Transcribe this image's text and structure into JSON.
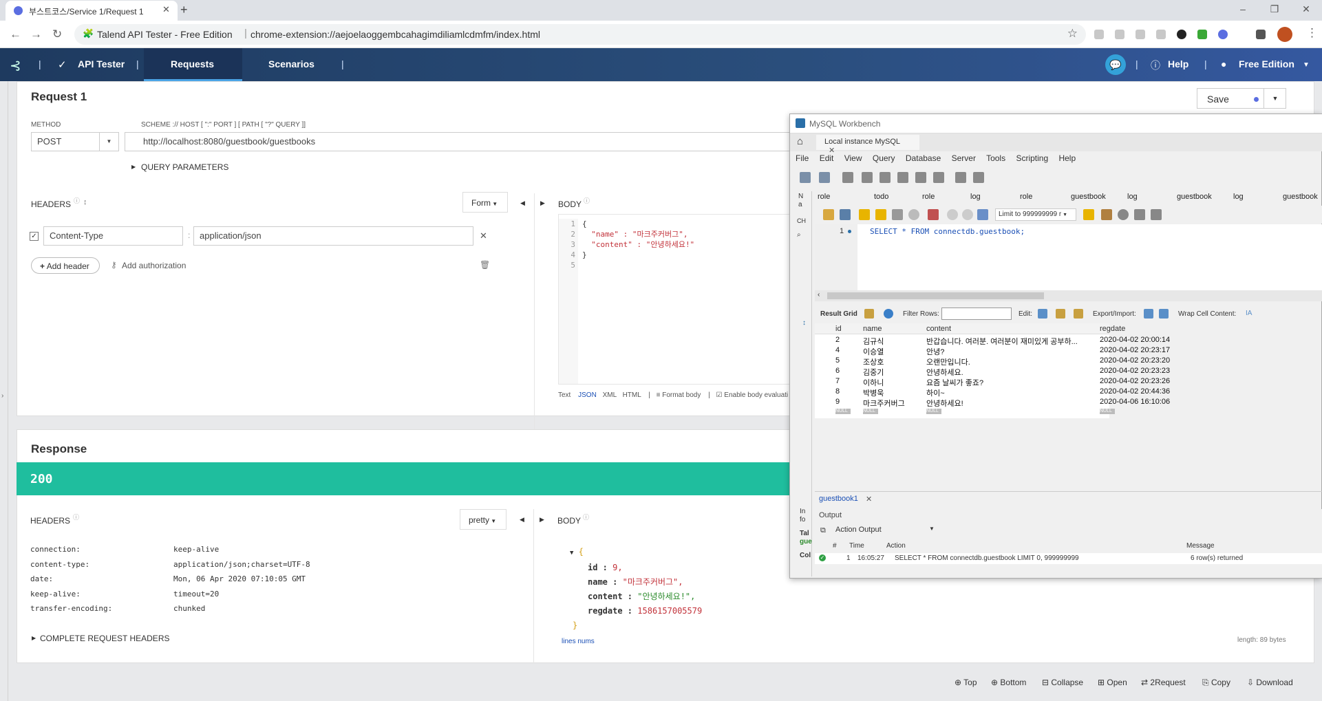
{
  "browser": {
    "tab_title": "부스트코스/Service 1/Request 1",
    "address_site": "Talend API Tester - Free Edition",
    "address_url": "chrome-extension://aejoelaoggembcahagimdiliamlcdmfm/index.html"
  },
  "app": {
    "brand": "API Tester",
    "tabs": [
      "Requests",
      "Scenarios"
    ],
    "help": "Help",
    "edition": "Free Edition"
  },
  "request": {
    "title": "Request 1",
    "save_label": "Save",
    "method_label": "METHOD",
    "method": "POST",
    "url_label": "SCHEME :// HOST [ \":\" PORT ] [ PATH [ \"?\" QUERY ]]",
    "url": "http://localhost:8080/guestbook/guestbooks",
    "query_params": "QUERY PARAMETERS",
    "headers_label": "HEADERS",
    "form_label": "Form",
    "header_name": "Content-Type",
    "header_value": "application/json",
    "add_header": "Add header",
    "add_auth": "Add authorization",
    "body_label": "BODY",
    "body_lines": [
      "{",
      "  \"name\" : \"마크주커버그\",",
      "  \"content\" : \"안녕하세요!\"",
      "}",
      ""
    ],
    "body_formats": [
      "Text",
      "JSON",
      "XML",
      "HTML"
    ],
    "format_body": "Format body",
    "enable_eval": "Enable body evaluati"
  },
  "response": {
    "title": "Response",
    "status": "200",
    "headers_label": "HEADERS",
    "pretty_label": "pretty",
    "headers": [
      {
        "k": "connection:",
        "v": "keep-alive"
      },
      {
        "k": "content-type:",
        "v": "application/json;charset=UTF-8"
      },
      {
        "k": "date:",
        "v": "Mon, 06 Apr 2020 07:10:05 GMT"
      },
      {
        "k": "keep-alive:",
        "v": "timeout=20"
      },
      {
        "k": "transfer-encoding:",
        "v": "chunked"
      }
    ],
    "complete_headers": "COMPLETE REQUEST HEADERS",
    "body_label": "BODY",
    "body": {
      "id": "9,",
      "name": "\"마크주커버그\",",
      "content": "\"안녕하세요!\",",
      "regdate": "1586157005579"
    },
    "lines_nums": "lines nums",
    "length": "length: 89 bytes"
  },
  "bottom_actions": [
    "Top",
    "Bottom",
    "Collapse",
    "Open",
    "2Request",
    "Copy",
    "Download"
  ],
  "mysql": {
    "window_title": "MySQL Workbench",
    "instance_tab": "Local instance MySQL",
    "menu": [
      "File",
      "Edit",
      "View",
      "Query",
      "Database",
      "Server",
      "Tools",
      "Scripting",
      "Help"
    ],
    "query_tabs": [
      "role",
      "todo",
      "role",
      "log",
      "role",
      "guestbook",
      "log",
      "guestbook",
      "log",
      "guestbook"
    ],
    "limit_label": "Limit to 999999999 r",
    "sql_line_num": "1",
    "sql": "SELECT * FROM connectdb.guestbook;",
    "result_grid": "Result Grid",
    "filter_rows": "Filter Rows:",
    "edit_label": "Edit:",
    "export_label": "Export/Import:",
    "wrap_label": "Wrap Cell Content:",
    "columns": [
      "id",
      "name",
      "content",
      "regdate"
    ],
    "rows": [
      [
        "2",
        "김규식",
        "반갑습니다. 여러분. 여러분이 재미있게 공부하...",
        "2020-04-02 20:00:14"
      ],
      [
        "4",
        "이승열",
        "안녕?",
        "2020-04-02 20:23:17"
      ],
      [
        "5",
        "조상호",
        "오랜만입니다.",
        "2020-04-02 20:23:20"
      ],
      [
        "6",
        "김중기",
        "안녕하세요.",
        "2020-04-02 20:23:23"
      ],
      [
        "7",
        "이하니",
        "요즘 날씨가 좋죠?",
        "2020-04-02 20:23:26"
      ],
      [
        "8",
        "박병욱",
        "하이~",
        "2020-04-02 20:44:36"
      ],
      [
        "9",
        "마크주커버그",
        "안녕하세요!",
        "2020-04-06 16:10:06"
      ],
      [
        "NULL",
        "NULL",
        "NULL",
        "NULL"
      ]
    ],
    "result_tab": "guestbook1",
    "output_label": "Output",
    "action_output": "Action Output",
    "output_cols": [
      "#",
      "Time",
      "Action",
      "Message"
    ],
    "output_row": {
      "num": "1",
      "time": "16:05:27",
      "action": "SELECT * FROM connectdb.guestbook LIMIT 0, 999999999",
      "message": "6 row(s) returned"
    },
    "side_fragments": [
      "N",
      "a",
      "CH",
      "In",
      "fo",
      "Tal",
      "gue",
      "Col"
    ]
  },
  "colors": {
    "header": "#1e3a5f",
    "accent": "#1fbe9e",
    "link": "#1a73e8"
  }
}
